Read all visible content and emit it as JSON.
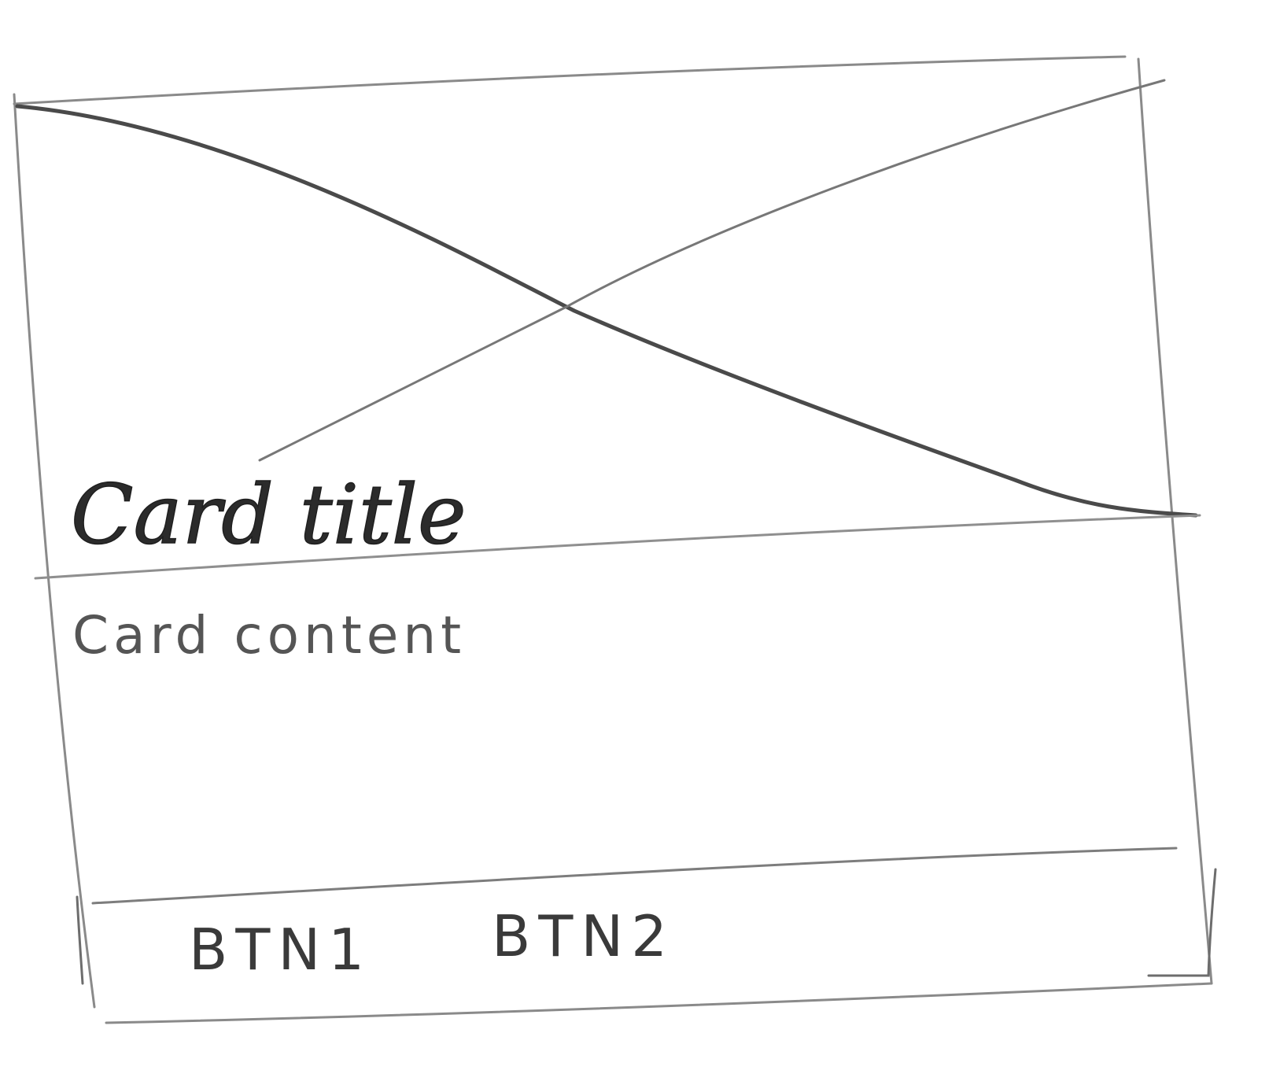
{
  "card": {
    "title": "Card title",
    "content": "Card content",
    "buttons": [
      {
        "label": "BTN1"
      },
      {
        "label": "BTN2"
      }
    ]
  }
}
